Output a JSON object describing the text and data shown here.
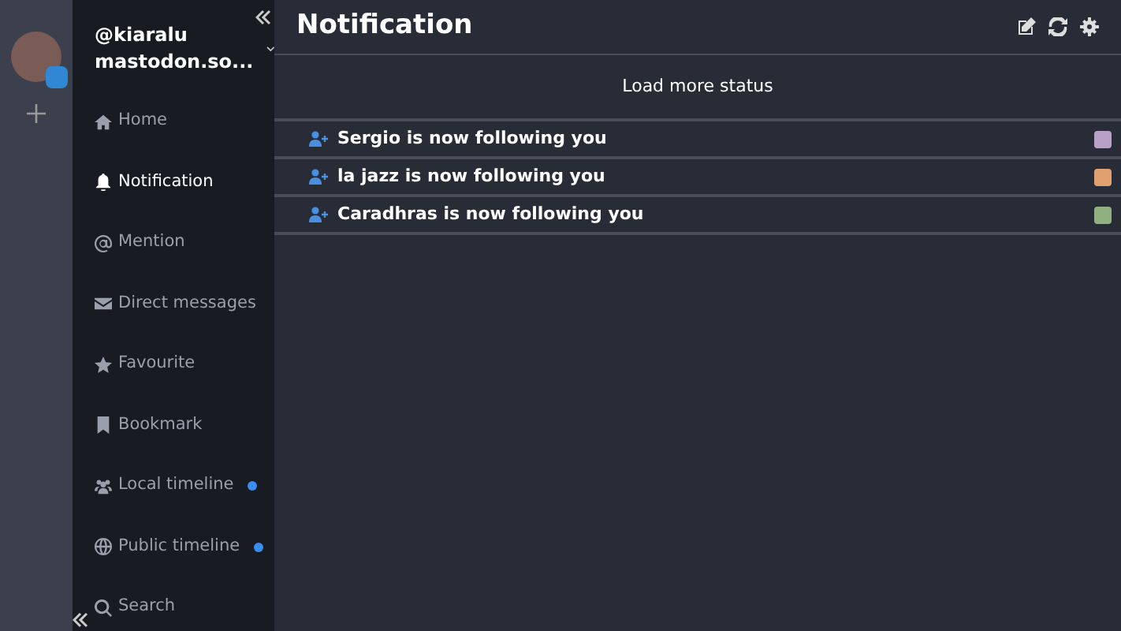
{
  "account": {
    "handle": "@kiaralu",
    "server": "mastodon.so..."
  },
  "sidebar": {
    "items": [
      {
        "label": "Home",
        "kind": "home",
        "selected": false,
        "unread": false
      },
      {
        "label": "Notification",
        "kind": "bell",
        "selected": true,
        "unread": false
      },
      {
        "label": "Mention",
        "kind": "at",
        "selected": false,
        "unread": false
      },
      {
        "label": "Direct messages",
        "kind": "mail",
        "selected": false,
        "unread": false
      },
      {
        "label": "Favourite",
        "kind": "star",
        "selected": false,
        "unread": false
      },
      {
        "label": "Bookmark",
        "kind": "bookmark",
        "selected": false,
        "unread": false
      },
      {
        "label": "Local timeline",
        "kind": "users",
        "selected": false,
        "unread": true
      },
      {
        "label": "Public timeline",
        "kind": "globe",
        "selected": false,
        "unread": true
      },
      {
        "label": "Search",
        "kind": "search",
        "selected": false,
        "unread": false
      }
    ]
  },
  "main": {
    "title": "Notification",
    "load_more": "Load more status",
    "notifications": [
      {
        "text": "Sergio is now following you"
      },
      {
        "text": "la jazz is now following you"
      },
      {
        "text": "Caradhras is now following you"
      }
    ]
  }
}
